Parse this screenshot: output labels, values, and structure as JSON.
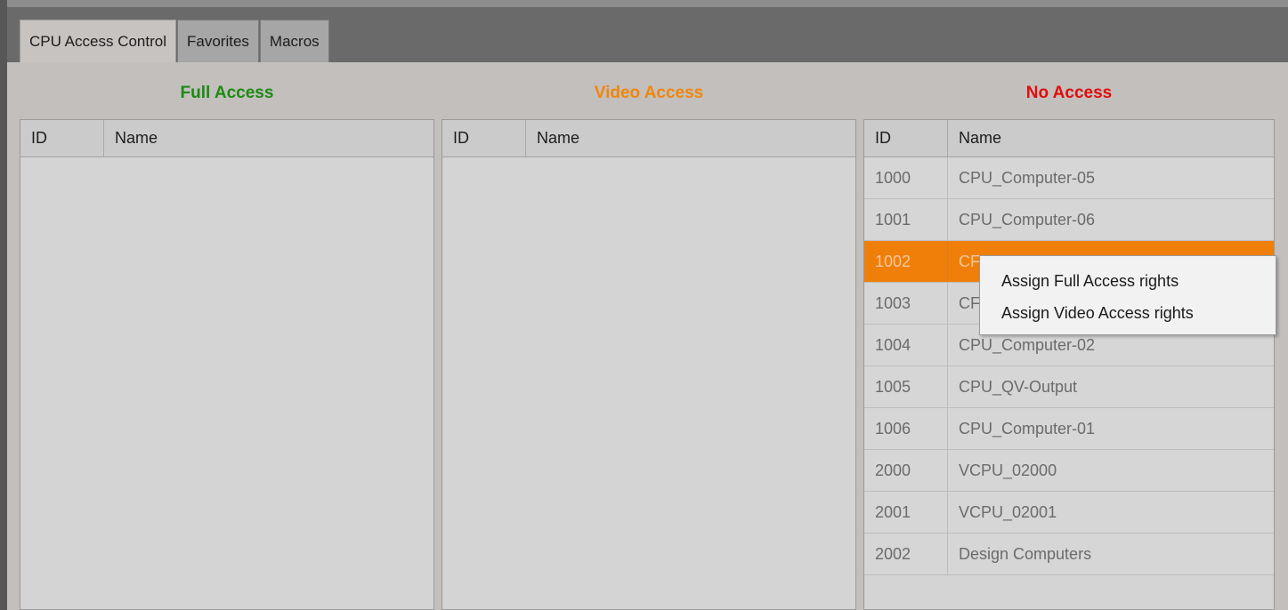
{
  "tabs": [
    {
      "label": "CPU Access Control",
      "active": true
    },
    {
      "label": "Favorites",
      "active": false
    },
    {
      "label": "Macros",
      "active": false
    }
  ],
  "panels": {
    "full": {
      "title": "Full Access",
      "color": "#1e8a12",
      "columns": [
        "ID",
        "Name"
      ],
      "rows": []
    },
    "video": {
      "title": "Video Access",
      "color": "#f0860c",
      "columns": [
        "ID",
        "Name"
      ],
      "rows": []
    },
    "none": {
      "title": "No Access",
      "color": "#e10c0c",
      "columns": [
        "ID",
        "Name"
      ],
      "rows": [
        {
          "id": "1000",
          "name": "CPU_Computer-05"
        },
        {
          "id": "1001",
          "name": "CPU_Computer-06"
        },
        {
          "id": "1002",
          "name": "CF",
          "selected": true
        },
        {
          "id": "1003",
          "name": "CF"
        },
        {
          "id": "1004",
          "name": "CPU_Computer-02"
        },
        {
          "id": "1005",
          "name": "CPU_QV-Output"
        },
        {
          "id": "1006",
          "name": "CPU_Computer-01"
        },
        {
          "id": "2000",
          "name": "VCPU_02000"
        },
        {
          "id": "2001",
          "name": "VCPU_02001"
        },
        {
          "id": "2002",
          "name": "Design Computers"
        }
      ]
    }
  },
  "context_menu": {
    "items": [
      "Assign Full Access rights",
      "Assign Video Access rights"
    ]
  }
}
